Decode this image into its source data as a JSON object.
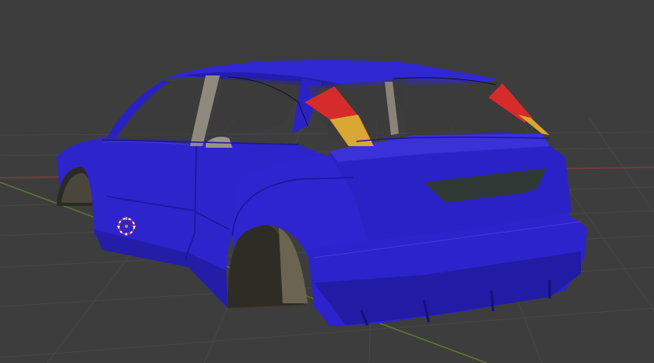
{
  "viewport": {
    "background_color": "#3d3d3d",
    "grid_color": "#4a4a4a",
    "x_axis_color": "#7a3b3b",
    "y_axis_color": "#5a7a2a"
  },
  "scene": {
    "object": "car-body",
    "body_color": "#2c22c8",
    "body_shadow_color": "#1a1490",
    "body_highlight_color": "#4a44e0",
    "interior_color": "#8a8478",
    "taillight_red": "#d62b2b",
    "taillight_amber": "#d9a833",
    "grille_color": "#2e3a36",
    "cursor_icon": "3d-cursor-icon"
  }
}
